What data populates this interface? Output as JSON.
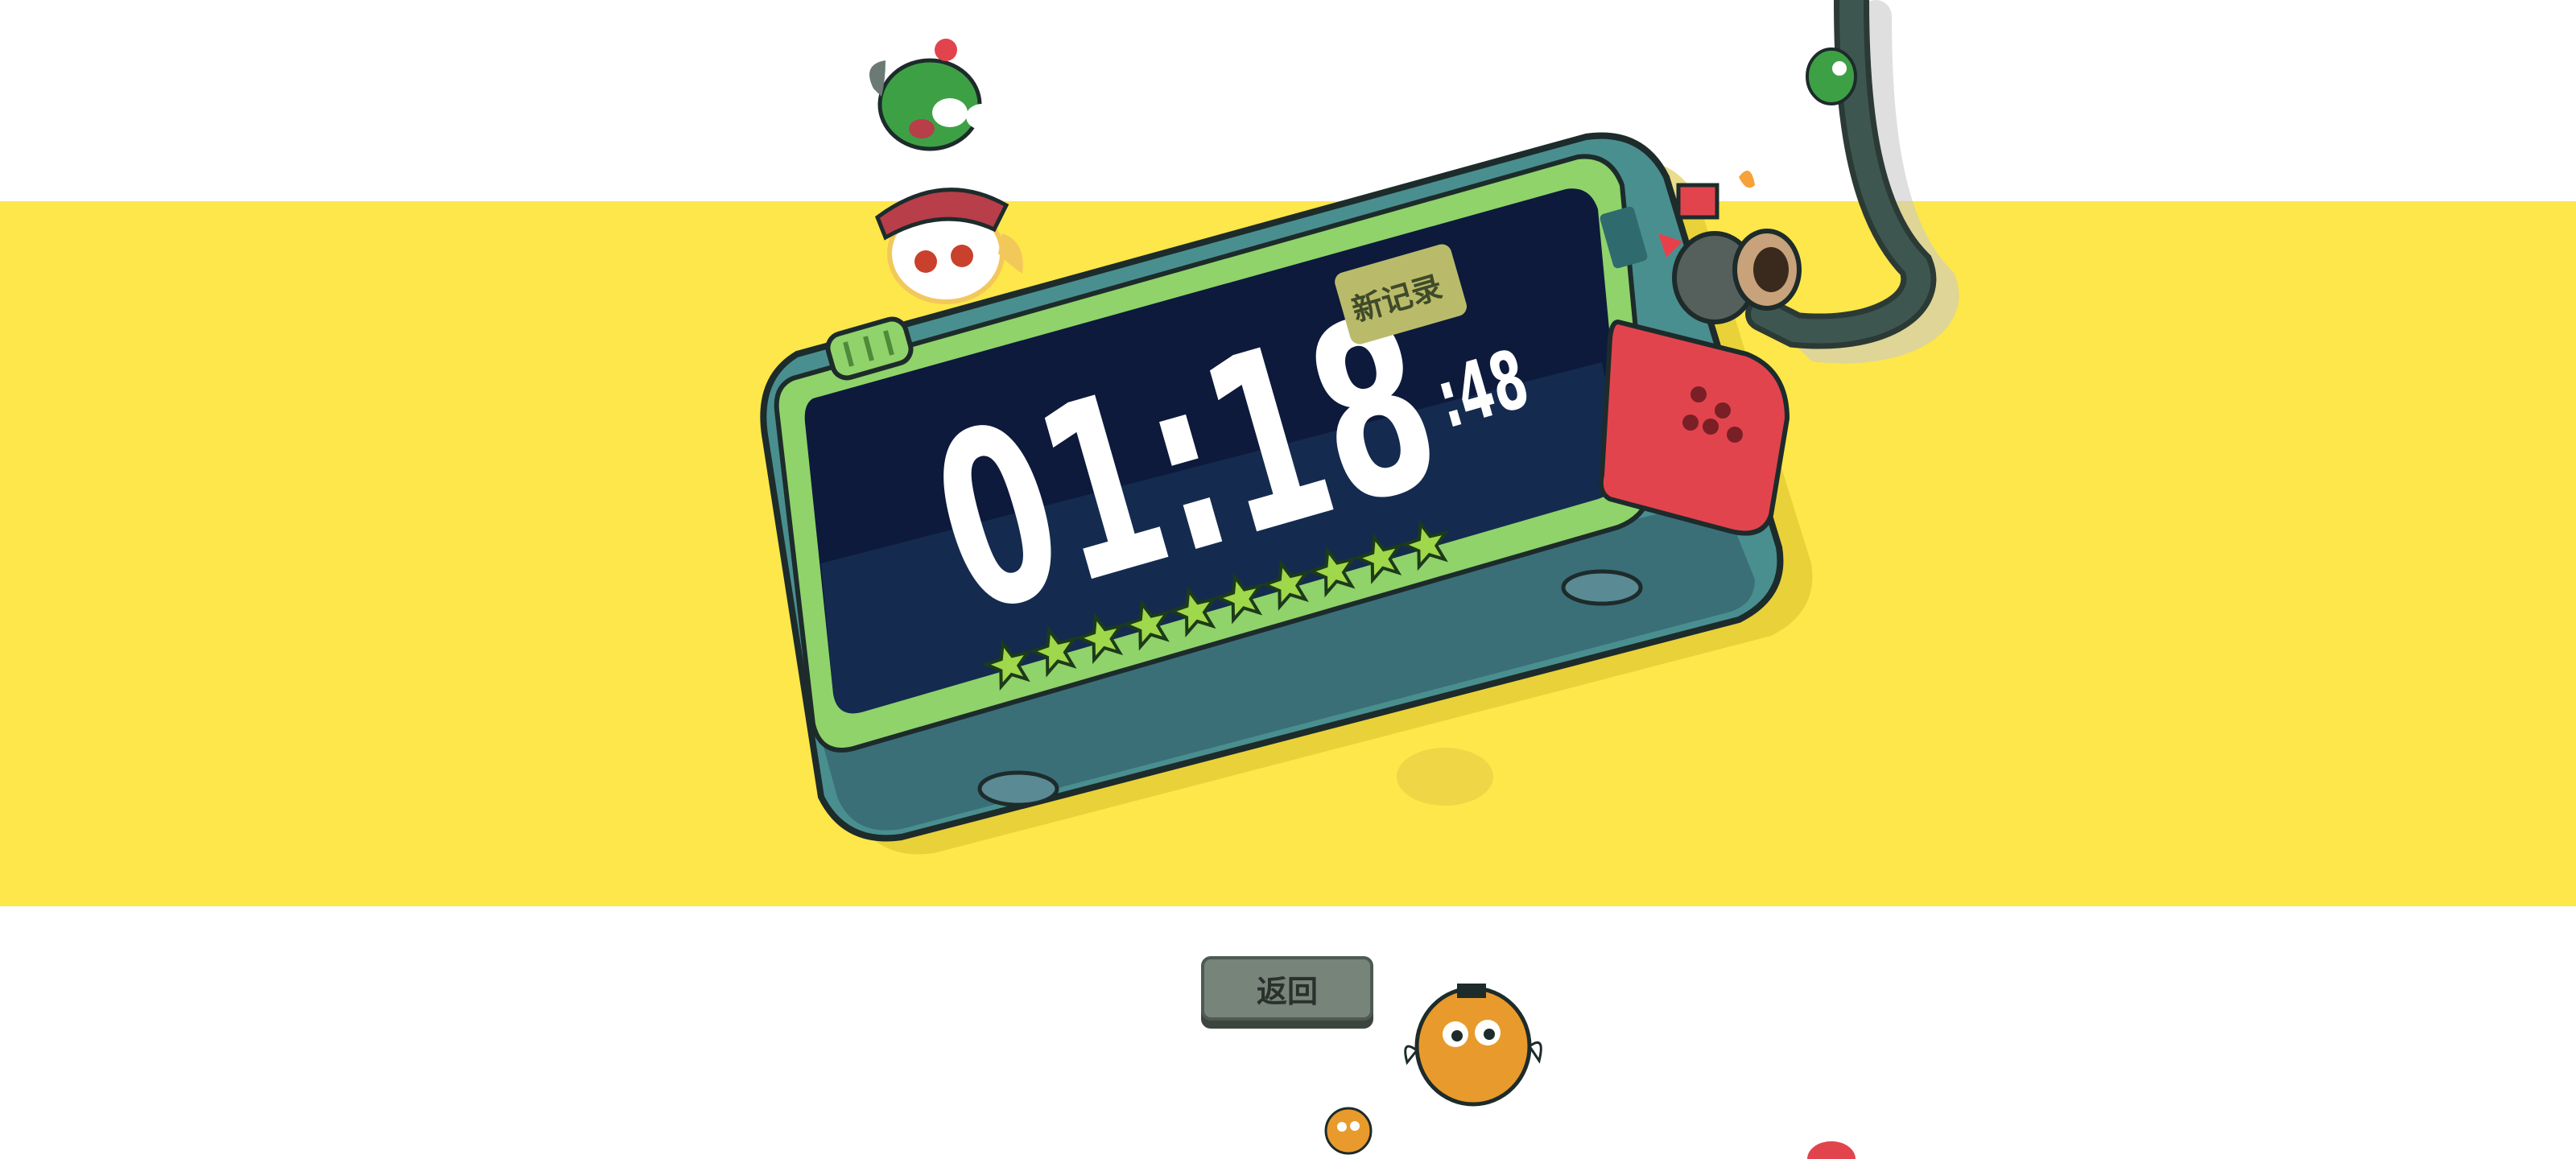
{
  "timer": {
    "main": "01:18",
    "fraction": ":48",
    "badge": "新记录",
    "stars_count": 10
  },
  "buttons": {
    "return_label": "返回"
  },
  "colors": {
    "band": "#fde74a",
    "screen": "#0d1a3c",
    "device_body": "#5fb3aa",
    "device_rim": "#8fd36a",
    "badge_bg": "#b9bb6a",
    "star": "#9fd84a",
    "button": "#77847a"
  }
}
